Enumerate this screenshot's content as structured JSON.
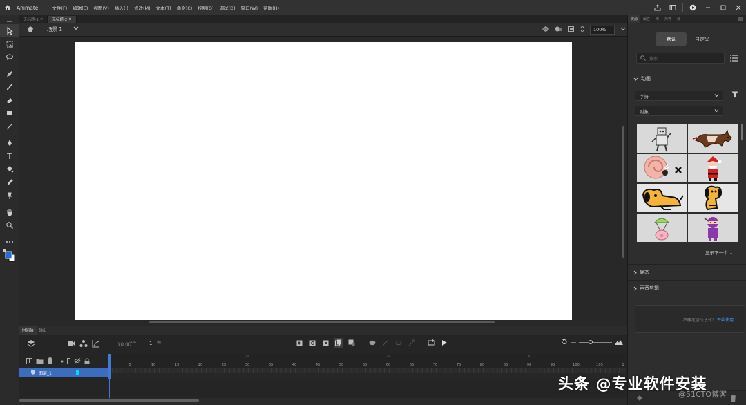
{
  "app": {
    "name": "Animate"
  },
  "menu": [
    "文件(F)",
    "编辑(E)",
    "视图(V)",
    "插入(I)",
    "修改(M)",
    "文本(T)",
    "命令(C)",
    "控制(O)",
    "调试(D)",
    "窗口(W)",
    "帮助(H)"
  ],
  "doc_tabs": [
    "无标题-1",
    "无标题-2"
  ],
  "scene": {
    "label": "场景 1",
    "zoom": "100%"
  },
  "timeline": {
    "tabs": [
      "时间轴",
      "输出"
    ],
    "fps": "30.00",
    "fps_unit": "FPS",
    "current_frame": "1",
    "frame_unit": "帧",
    "ruler_marks": [
      "5",
      "10",
      "15",
      "20",
      "25",
      "30",
      "35",
      "40",
      "45",
      "50",
      "55",
      "60",
      "65",
      "70",
      "75",
      "80",
      "85",
      "90",
      "95",
      "100",
      "105",
      "1"
    ],
    "ruler_seconds": [
      "1s",
      "2s",
      "3s"
    ],
    "layer_name": "图层_1",
    "layer_color": "#00d8ff"
  },
  "right_panel": {
    "tabs": [
      "资源",
      "属性",
      "库",
      "对齐",
      "帧"
    ],
    "segments": [
      "默认",
      "自定义"
    ],
    "search_placeholder": "搜索",
    "section_animation": "动画",
    "dropdown_1": "字符",
    "dropdown_2": "对象",
    "show_next": "显示下一个 ↓",
    "section_static": "静态",
    "section_sound": "声音剪辑",
    "promo_text": "不确定运作方式？",
    "promo_link": "开始使用"
  },
  "watermark": {
    "main": "头条 @专业软件安装",
    "sub": "@51CTO博客"
  },
  "colors": {
    "accent": "#3e7bd6",
    "stage": "#ffffff",
    "fill_color": "#1e6fd9"
  }
}
